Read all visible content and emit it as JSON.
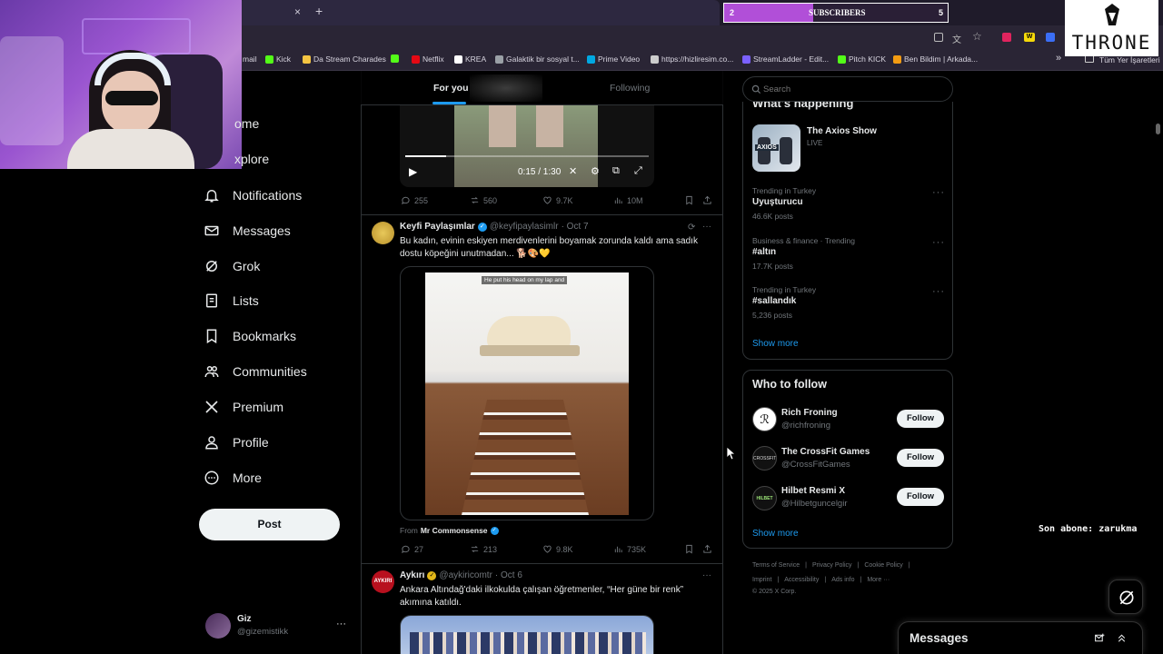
{
  "browser": {
    "tab_close": "×",
    "new_tab": "+",
    "bookmarks": [
      {
        "label": "mail",
        "color": "#ea4335"
      },
      {
        "label": "Kick",
        "color": "#53fc18"
      },
      {
        "label": "Da Stream Charades",
        "color": "#f4c542"
      },
      {
        "label": "",
        "color": "#53fc18"
      },
      {
        "label": "Netflix",
        "color": "#e50914"
      },
      {
        "label": "KREA",
        "color": "#ffffff"
      },
      {
        "label": "Galaktik bir sosyal t...",
        "color": "#9aa0a6"
      },
      {
        "label": "Prime Video",
        "color": "#00a8e1"
      },
      {
        "label": "https://hizliresim.co...",
        "color": "#cccccc"
      },
      {
        "label": "StreamLadder - Edit...",
        "color": "#7b61ff"
      },
      {
        "label": "Pitch KICK",
        "color": "#53fc18"
      },
      {
        "label": "Ben Bildim | Arkada...",
        "color": "#f39c12"
      }
    ],
    "bookmarks_overflow": "»",
    "all_bookmarks": "Tüm Yer İşaretleri"
  },
  "overlay": {
    "sub_goal_current": "2",
    "sub_goal_label": "SUBSCRIBERS",
    "sub_goal_target": "5",
    "sub_goal_progress": 0.4,
    "brand": "THRONE",
    "last_sub": "Son abone: zarukma"
  },
  "nav": {
    "items": [
      {
        "label": "ome",
        "icon": "home-icon"
      },
      {
        "label": "xplore",
        "icon": "search-icon"
      },
      {
        "label": "Notifications",
        "icon": "bell-icon"
      },
      {
        "label": "Messages",
        "icon": "mail-icon"
      },
      {
        "label": "Grok",
        "icon": "grok-icon"
      },
      {
        "label": "Lists",
        "icon": "list-icon"
      },
      {
        "label": "Bookmarks",
        "icon": "bookmark-icon"
      },
      {
        "label": "Communities",
        "icon": "people-icon"
      },
      {
        "label": "Premium",
        "icon": "x-logo-icon"
      },
      {
        "label": "Profile",
        "icon": "person-icon"
      },
      {
        "label": "More",
        "icon": "more-circle-icon"
      }
    ],
    "post_button": "Post",
    "account_name": "Giz",
    "account_handle": "@gizemistikk",
    "account_more": "···"
  },
  "feed": {
    "tabs": [
      "For you",
      "Following"
    ],
    "video": {
      "time": "0:15 / 1:30",
      "progress": 0.167,
      "stats": {
        "replies": "255",
        "reposts": "560",
        "likes": "9.7K",
        "views": "10M"
      }
    },
    "post1": {
      "name": "Keyfi Paylaşımlar",
      "handle": "@keyfipaylasimlr",
      "date": "· Oct 7",
      "text": "Bu kadın, evinin eskiyen merdivenlerini boyamak zorunda kaldı ama sadık dostu köpeğini unutmadan... 🐕🎨💛",
      "image_caption": "He put his head on my lap and",
      "from_label": "From",
      "from_name": "Mr Commonsense",
      "stats": {
        "replies": "27",
        "reposts": "213",
        "likes": "9.8K",
        "views": "735K"
      }
    },
    "post2": {
      "name": "Aykırı",
      "avatar_text": "AYKIRI",
      "handle": "@aykiricomtr",
      "date": "· Oct 6",
      "text": "Ankara Altındağ'daki ilkokulda çalışan öğretmenler, “Her güne bir renk” akımına katıldı."
    }
  },
  "sidebar": {
    "search_placeholder": "Search",
    "happening_title": "What's happening",
    "live": {
      "title": "The Axios Show",
      "badge": "LIVE",
      "thumb_label": "AXIOS"
    },
    "trends": [
      {
        "category": "Trending in Turkey",
        "title": "Uyuşturucu",
        "count": "46.6K posts"
      },
      {
        "category": "Business & finance · Trending",
        "title": "#altın",
        "count": "17.7K posts"
      },
      {
        "category": "Trending in Turkey",
        "title": "#sallandık",
        "count": "5,236 posts"
      }
    ],
    "show_more": "Show more",
    "wtf_title": "Who to follow",
    "wtf": [
      {
        "name": "Rich Froning",
        "handle": "@richfroning",
        "button": "Follow"
      },
      {
        "name": "The CrossFit Games",
        "handle": "@CrossFitGames",
        "button": "Follow"
      },
      {
        "name": "Hilbet Resmi X",
        "handle": "@Hilbetguncelgir",
        "button": "Follow"
      }
    ],
    "wtf_show_more": "Show more",
    "footer": {
      "row1": [
        "Terms of Service",
        "Privacy Policy",
        "Cookie Policy"
      ],
      "row2": [
        "Imprint",
        "Accessibility",
        "Ads info",
        "More ···"
      ],
      "copyright": "© 2025 X Corp."
    }
  },
  "messages_drawer": {
    "title": "Messages"
  },
  "colors": {
    "accent": "#1d9bf0",
    "verified": "#1d9bf0",
    "purple": "#b14fd8"
  }
}
